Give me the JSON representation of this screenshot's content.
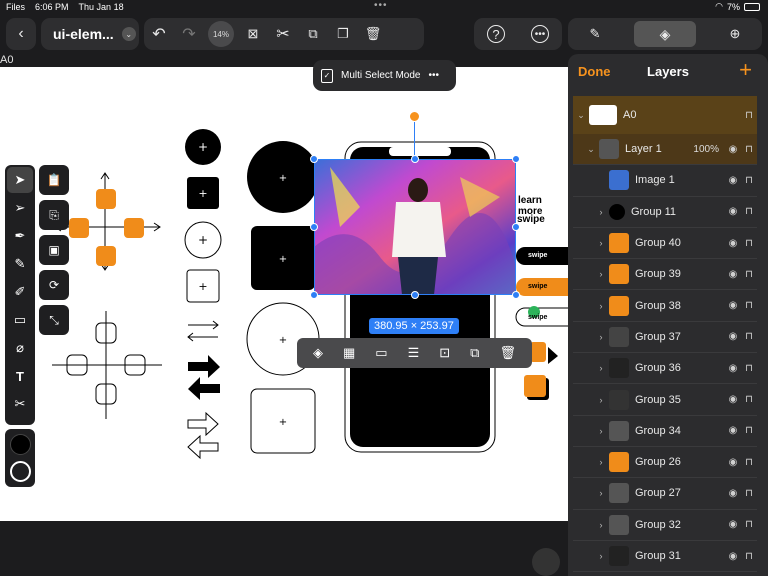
{
  "status": {
    "app": "Files",
    "time": "6:06 PM",
    "date": "Thu Jan 18",
    "battery": "7%"
  },
  "toolbar": {
    "doc_title": "ui-elem...",
    "zoom": "14%"
  },
  "artboard_label": "A0",
  "mode_banner": {
    "label": "Multi Select Mode"
  },
  "selection": {
    "dimensions": "380.95 × 253.97"
  },
  "canvas_text": {
    "learn_more": "learn more",
    "swipe": "swipe"
  },
  "panel": {
    "done": "Done",
    "title": "Layers",
    "add": "+",
    "layers": [
      {
        "name": "A0",
        "kind": "artboard"
      },
      {
        "name": "Layer 1",
        "kind": "layer",
        "opacity": "100%"
      },
      {
        "name": "Image 1",
        "kind": "selected"
      },
      {
        "name": "Group 11",
        "kind": "selected"
      },
      {
        "name": "Group 40",
        "kind": "group"
      },
      {
        "name": "Group 39",
        "kind": "group"
      },
      {
        "name": "Group 38",
        "kind": "group"
      },
      {
        "name": "Group 37",
        "kind": "group"
      },
      {
        "name": "Group 36",
        "kind": "group"
      },
      {
        "name": "Group 35",
        "kind": "group"
      },
      {
        "name": "Group 34",
        "kind": "group"
      },
      {
        "name": "Group 26",
        "kind": "group"
      },
      {
        "name": "Group 27",
        "kind": "group"
      },
      {
        "name": "Group 32",
        "kind": "group"
      },
      {
        "name": "Group 31",
        "kind": "group"
      }
    ]
  },
  "colors": {
    "accent": "#f7931e",
    "selection": "#2e7ff6",
    "panel_bg": "#2c2c2e"
  }
}
